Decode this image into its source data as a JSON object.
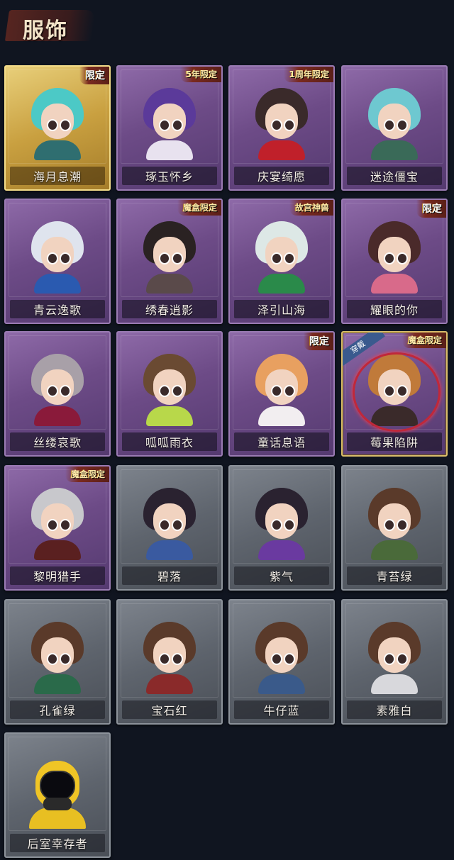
{
  "header": {
    "title": "服饰"
  },
  "outfits": [
    {
      "name": "海月息潮",
      "badge": "限定",
      "frame": "gold",
      "hair": "#4cc9c6",
      "body": "#2f6e70"
    },
    {
      "name": "琢玉怀乡",
      "badge": "5年限定",
      "frame": "purple",
      "hair": "#5b3a9a",
      "body": "#e8e2ef"
    },
    {
      "name": "庆宴绮愿",
      "badge": "1周年限定",
      "frame": "purple",
      "hair": "#3a2a2a",
      "body": "#c0202a"
    },
    {
      "name": "迷途僵宝",
      "badge": "",
      "frame": "purple",
      "hair": "#6ec8d0",
      "body": "#3a6a58"
    },
    {
      "name": "青云逸歌",
      "badge": "",
      "frame": "purple",
      "hair": "#dfe4ee",
      "body": "#2a5ab0"
    },
    {
      "name": "绣春逍影",
      "badge": "魔盒限定",
      "frame": "purple",
      "hair": "#2a2222",
      "body": "#5a4a4a"
    },
    {
      "name": "泽引山海",
      "badge": "故宫神兽",
      "frame": "purple",
      "hair": "#dde8e6",
      "body": "#2a8a4a"
    },
    {
      "name": "耀眼的你",
      "badge": "限定",
      "frame": "purple",
      "hair": "#4a2a2a",
      "body": "#d86a8a"
    },
    {
      "name": "丝缕哀歌",
      "badge": "",
      "frame": "purple",
      "hair": "#a8a0a8",
      "body": "#8a1a3a"
    },
    {
      "name": "呱呱雨衣",
      "badge": "",
      "frame": "purple",
      "hair": "#6a4a32",
      "body": "#b8d84a"
    },
    {
      "name": "童话息语",
      "badge": "限定",
      "frame": "purple",
      "hair": "#e8a060",
      "body": "#f2eef0"
    },
    {
      "name": "莓果陷阱",
      "badge": "魔盒限定",
      "frame": "purple",
      "hair": "#c07a3a",
      "body": "#3a2a2a",
      "selected": true,
      "wear": "穿戴"
    },
    {
      "name": "黎明猎手",
      "badge": "魔盒限定",
      "frame": "purple",
      "hair": "#c8c8cc",
      "body": "#5a2020"
    },
    {
      "name": "碧落",
      "badge": "",
      "frame": "gray",
      "hair": "#2a2230",
      "body": "#3a5aa0"
    },
    {
      "name": "紫气",
      "badge": "",
      "frame": "gray",
      "hair": "#2a2230",
      "body": "#6a3aa0"
    },
    {
      "name": "青苔绿",
      "badge": "",
      "frame": "gray",
      "hair": "#5a3a2a",
      "body": "#4a6a3a"
    },
    {
      "name": "孔雀绿",
      "badge": "",
      "frame": "gray",
      "hair": "#5a3a2a",
      "body": "#2a6a4a"
    },
    {
      "name": "宝石红",
      "badge": "",
      "frame": "gray",
      "hair": "#5a3a2a",
      "body": "#8a2a2a"
    },
    {
      "name": "牛仔蓝",
      "badge": "",
      "frame": "gray",
      "hair": "#5a3a2a",
      "body": "#3a5a8a"
    },
    {
      "name": "素雅白",
      "badge": "",
      "frame": "gray",
      "hair": "#5a3a2a",
      "body": "#d8d8dc"
    },
    {
      "name": "后室幸存者",
      "badge": "",
      "frame": "gray",
      "special": "hazmat"
    }
  ]
}
